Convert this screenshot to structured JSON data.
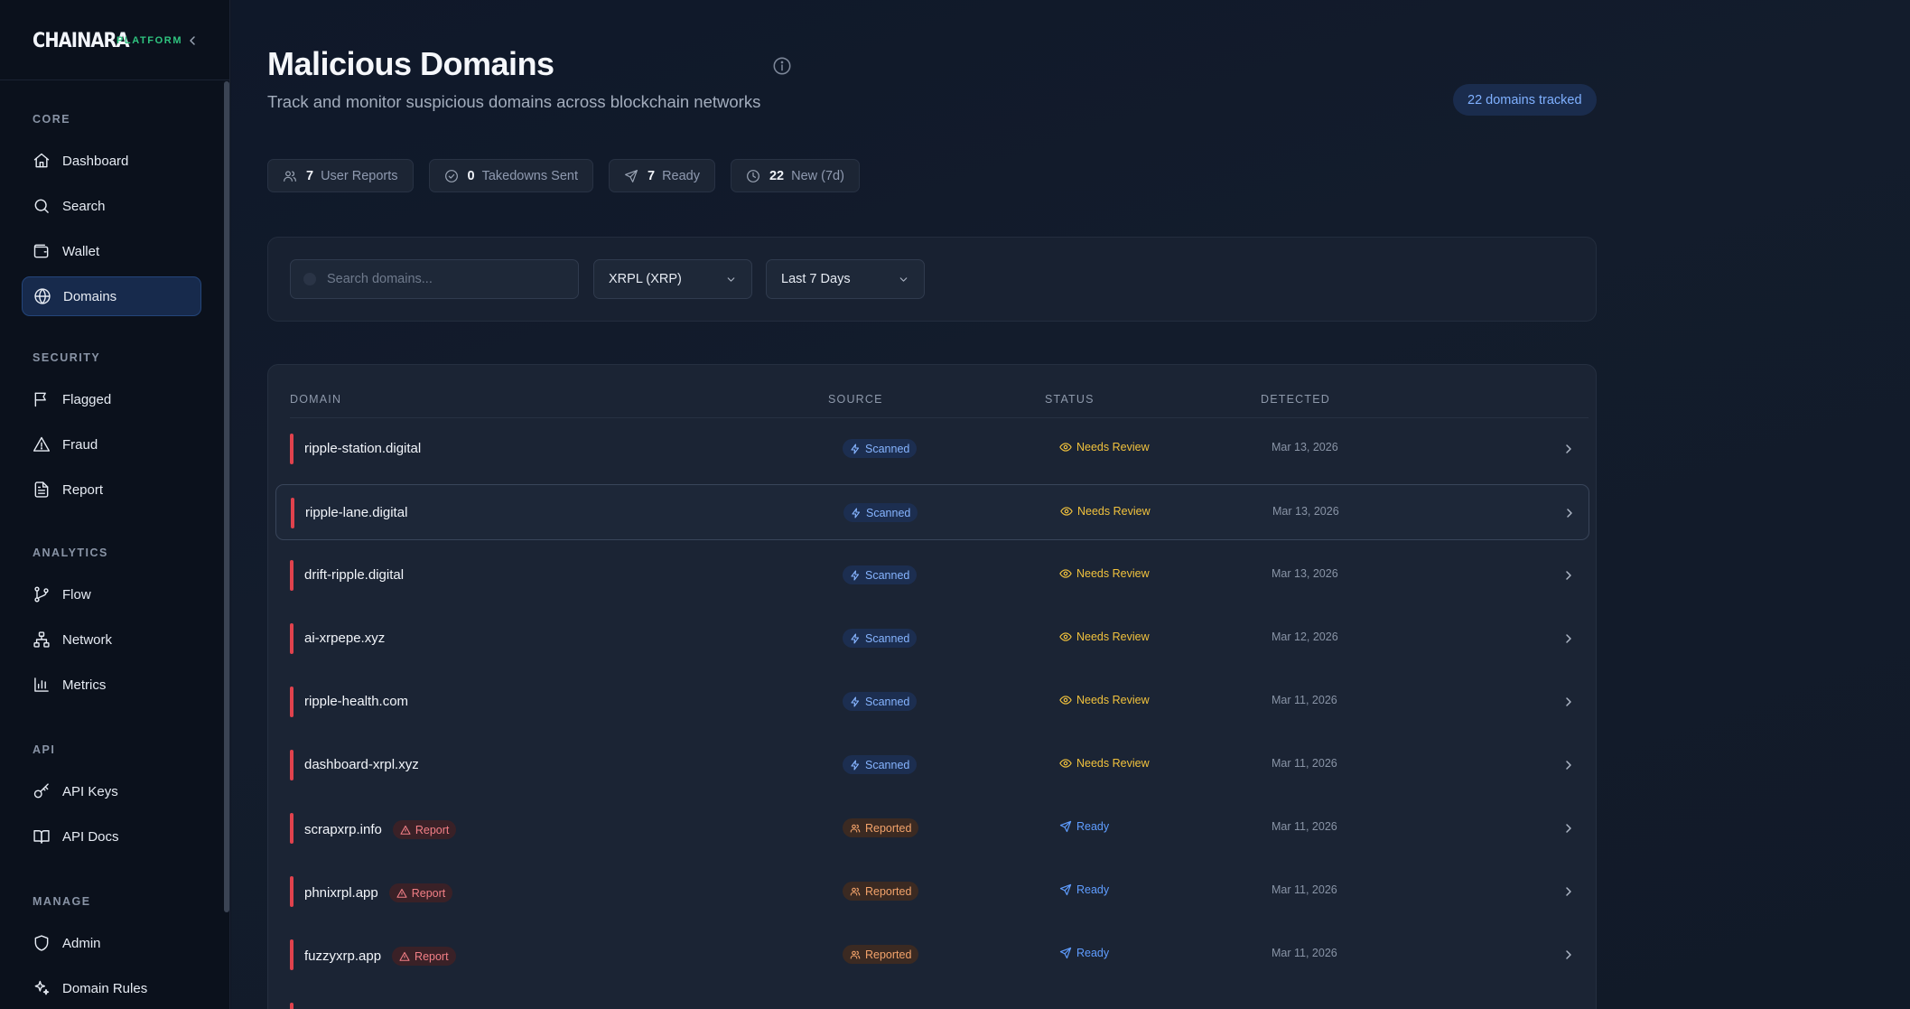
{
  "brand": {
    "name": "CHAINARA",
    "tag": "PLATFORM"
  },
  "sidebar": {
    "sections": [
      {
        "label": "CORE",
        "items": [
          {
            "label": "Dashboard",
            "icon": "home-icon"
          },
          {
            "label": "Search",
            "icon": "search-icon"
          },
          {
            "label": "Wallet",
            "icon": "wallet-icon"
          },
          {
            "label": "Domains",
            "icon": "globe-icon",
            "active": true
          }
        ]
      },
      {
        "label": "SECURITY",
        "items": [
          {
            "label": "Flagged",
            "icon": "flag-icon"
          },
          {
            "label": "Fraud",
            "icon": "alert-triangle-icon"
          },
          {
            "label": "Report",
            "icon": "file-text-icon"
          }
        ]
      },
      {
        "label": "ANALYTICS",
        "items": [
          {
            "label": "Flow",
            "icon": "git-branch-icon"
          },
          {
            "label": "Network",
            "icon": "network-icon"
          },
          {
            "label": "Metrics",
            "icon": "bar-chart-icon"
          }
        ]
      },
      {
        "label": "API",
        "items": [
          {
            "label": "API Keys",
            "icon": "key-icon"
          },
          {
            "label": "API Docs",
            "icon": "book-icon"
          }
        ]
      },
      {
        "label": "MANAGE",
        "items": [
          {
            "label": "Admin",
            "icon": "shield-icon"
          },
          {
            "label": "Domain Rules",
            "icon": "sparkles-icon"
          }
        ]
      }
    ]
  },
  "header": {
    "title": "Malicious Domains",
    "subtitle": "Track and monitor suspicious domains across blockchain networks",
    "tracked_badge": "22 domains tracked"
  },
  "stats": [
    {
      "value": "7",
      "label": "User Reports",
      "icon": "users-icon"
    },
    {
      "value": "0",
      "label": "Takedowns Sent",
      "icon": "check-circle-icon"
    },
    {
      "value": "7",
      "label": "Ready",
      "icon": "send-icon"
    },
    {
      "value": "22",
      "label": "New (7d)",
      "icon": "clock-icon"
    }
  ],
  "filters": {
    "search_placeholder": "Search domains...",
    "network": "XRPL (XRP)",
    "period": "Last 7 Days"
  },
  "table": {
    "columns": [
      "DOMAIN",
      "SOURCE",
      "STATUS",
      "DETECTED"
    ],
    "rows": [
      {
        "domain": "ripple-station.digital",
        "tag": "",
        "source": "Scanned",
        "status": "Needs Review",
        "detected": "Mar 13, 2026"
      },
      {
        "domain": "ripple-lane.digital",
        "tag": "",
        "source": "Scanned",
        "status": "Needs Review",
        "detected": "Mar 13, 2026"
      },
      {
        "domain": "drift-ripple.digital",
        "tag": "",
        "source": "Scanned",
        "status": "Needs Review",
        "detected": "Mar 13, 2026"
      },
      {
        "domain": "ai-xrpepe.xyz",
        "tag": "",
        "source": "Scanned",
        "status": "Needs Review",
        "detected": "Mar 12, 2026"
      },
      {
        "domain": "ripple-health.com",
        "tag": "",
        "source": "Scanned",
        "status": "Needs Review",
        "detected": "Mar 11, 2026"
      },
      {
        "domain": "dashboard-xrpl.xyz",
        "tag": "",
        "source": "Scanned",
        "status": "Needs Review",
        "detected": "Mar 11, 2026"
      },
      {
        "domain": "scrapxrp.info",
        "tag": "Report",
        "source": "Reported",
        "status": "Ready",
        "detected": "Mar 11, 2026"
      },
      {
        "domain": "phnixrpl.app",
        "tag": "Report",
        "source": "Reported",
        "status": "Ready",
        "detected": "Mar 11, 2026"
      },
      {
        "domain": "fuzzyxrp.app",
        "tag": "Report",
        "source": "Reported",
        "status": "Ready",
        "detected": "Mar 11, 2026"
      },
      {
        "domain": "",
        "tag": "",
        "source": "",
        "status": "",
        "detected": ""
      }
    ]
  },
  "colors": {
    "accent": "#2fc47f",
    "danger": "#e0424d",
    "review": "#f1c23d",
    "ready": "#5f9dff",
    "scanned": "#86b4ff",
    "reported": "#f3a36b"
  }
}
